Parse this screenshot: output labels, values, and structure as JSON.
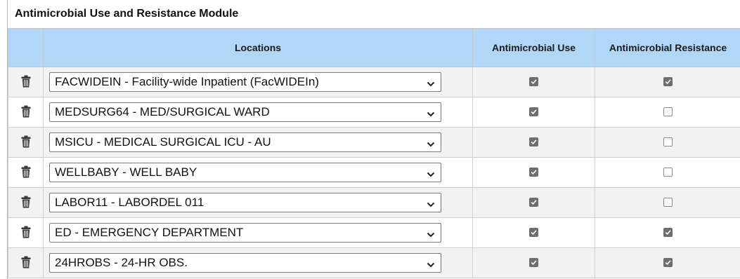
{
  "module": {
    "title": "Antimicrobial Use and Resistance Module"
  },
  "table": {
    "headers": {
      "delete": "",
      "locations": "Locations",
      "use": "Antimicrobial Use",
      "resistance": "Antimicrobial Resistance"
    },
    "rows": [
      {
        "location": "FACWIDEIN - Facility-wide Inpatient (FacWIDEIn)",
        "use": true,
        "resistance": true
      },
      {
        "location": "MEDSURG64 - MED/SURGICAL WARD",
        "use": true,
        "resistance": false
      },
      {
        "location": "MSICU - MEDICAL SURGICAL ICU - AU",
        "use": true,
        "resistance": false
      },
      {
        "location": "WELLBABY - WELL BABY",
        "use": true,
        "resistance": false
      },
      {
        "location": "LABOR11 - LABORDEL 011",
        "use": true,
        "resistance": false
      },
      {
        "location": "ED - EMERGENCY DEPARTMENT",
        "use": true,
        "resistance": true
      },
      {
        "location": "24HROBS - 24-HR OBS.",
        "use": true,
        "resistance": true
      }
    ]
  },
  "icons": {
    "delete": "trash-icon",
    "dropdown": "chevron-down-icon",
    "checked": "checkbox-checked",
    "unchecked": "checkbox-unchecked"
  },
  "colors": {
    "header_bg": "#b2d6f7",
    "row_alt_bg": "#f2f2f2",
    "checkbox_checked": "#6e6e6e"
  }
}
